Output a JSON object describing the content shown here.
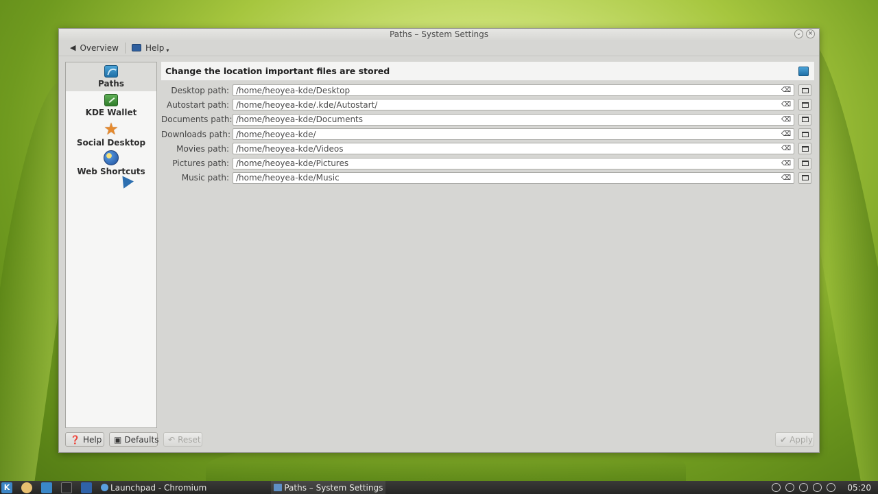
{
  "window": {
    "title": "Paths – System Settings"
  },
  "toolbar": {
    "overview_label": "Overview",
    "help_label": "Help"
  },
  "sidebar": {
    "items": [
      {
        "label": "Paths",
        "icon": "paths-icon",
        "selected": true
      },
      {
        "label": "KDE Wallet",
        "icon": "wallet-icon",
        "selected": false
      },
      {
        "label": "Social Desktop",
        "icon": "star-icon",
        "selected": false
      },
      {
        "label": "Web Shortcuts",
        "icon": "globe-icon",
        "selected": false
      }
    ]
  },
  "header": {
    "title": "Change the location important files are stored"
  },
  "paths": [
    {
      "label": "Desktop path:",
      "value": "/home/heoyea-kde/Desktop"
    },
    {
      "label": "Autostart path:",
      "value": "/home/heoyea-kde/.kde/Autostart/"
    },
    {
      "label": "Documents path:",
      "value": "/home/heoyea-kde/Documents"
    },
    {
      "label": "Downloads path:",
      "value": "/home/heoyea-kde/"
    },
    {
      "label": "Movies path:",
      "value": "/home/heoyea-kde/Videos"
    },
    {
      "label": "Pictures path:",
      "value": "/home/heoyea-kde/Pictures"
    },
    {
      "label": "Music path:",
      "value": "/home/heoyea-kde/Music"
    }
  ],
  "buttons": {
    "help": "Help",
    "defaults": "Defaults",
    "reset": "Reset",
    "apply": "Apply"
  },
  "taskbar": {
    "tasks": [
      {
        "label": "Launchpad - Chromium",
        "icon": "chromium-icon"
      },
      {
        "label": "Paths – System Settings",
        "icon": "system-settings-icon"
      }
    ],
    "clock": "05:20"
  },
  "colors": {
    "window_bg": "#d6d6d3",
    "sidebar_bg": "#f6f6f5",
    "taskbar_bg": "#2e2e2c",
    "accent": "#2d6fb0"
  }
}
